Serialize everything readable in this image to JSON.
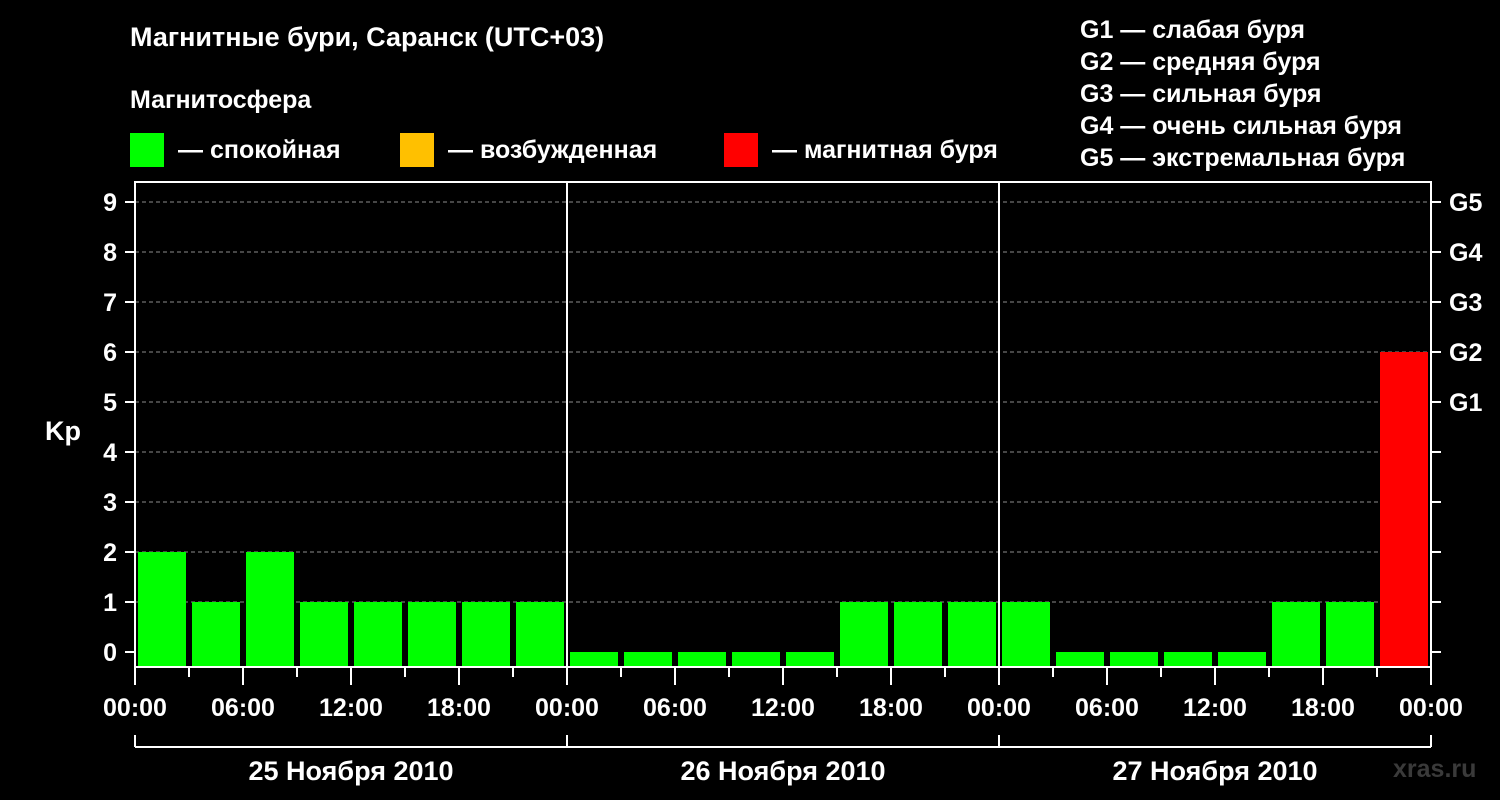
{
  "header": {
    "title": "Магнитные бури, Саранск (UTC+03)",
    "subtitle": "Магнитосфера",
    "legend": [
      {
        "label": "— спокойная",
        "color": "#00ff00"
      },
      {
        "label": "— возбужденная",
        "color": "#ffc000"
      },
      {
        "label": "— магнитная буря",
        "color": "#ff0000"
      }
    ],
    "g_scale": [
      "G1 — слабая буря",
      "G2 — средняя буря",
      "G3 — сильная буря",
      "G4 — очень сильная буря",
      "G5 — экстремальная буря"
    ]
  },
  "chart_data": {
    "type": "bar",
    "ylabel": "Kp",
    "ylim": [
      0,
      9
    ],
    "y_ticks": [
      "0",
      "1",
      "2",
      "3",
      "4",
      "5",
      "6",
      "7",
      "8",
      "9"
    ],
    "right_ticks": [
      {
        "kp": 5,
        "label": "G1"
      },
      {
        "kp": 6,
        "label": "G2"
      },
      {
        "kp": 7,
        "label": "G3"
      },
      {
        "kp": 8,
        "label": "G4"
      },
      {
        "kp": 9,
        "label": "G5"
      }
    ],
    "x_tick_labels": [
      "00:00",
      "06:00",
      "12:00",
      "18:00",
      "00:00",
      "06:00",
      "12:00",
      "18:00",
      "00:00",
      "06:00",
      "12:00",
      "18:00",
      "00:00"
    ],
    "days": [
      "25 Ноября 2010",
      "26 Ноября 2010",
      "27 Ноября 2010"
    ],
    "interval_hours": 3,
    "values": [
      2,
      1,
      2,
      1,
      1,
      1,
      1,
      1,
      0,
      0,
      0,
      0,
      0,
      1,
      1,
      1,
      1,
      0,
      0,
      0,
      0,
      1,
      1,
      6
    ],
    "colors": {
      "quiet": "#00ff00",
      "active": "#ffc000",
      "storm": "#ff0000"
    },
    "grid": true
  },
  "watermark": "xras.ru"
}
